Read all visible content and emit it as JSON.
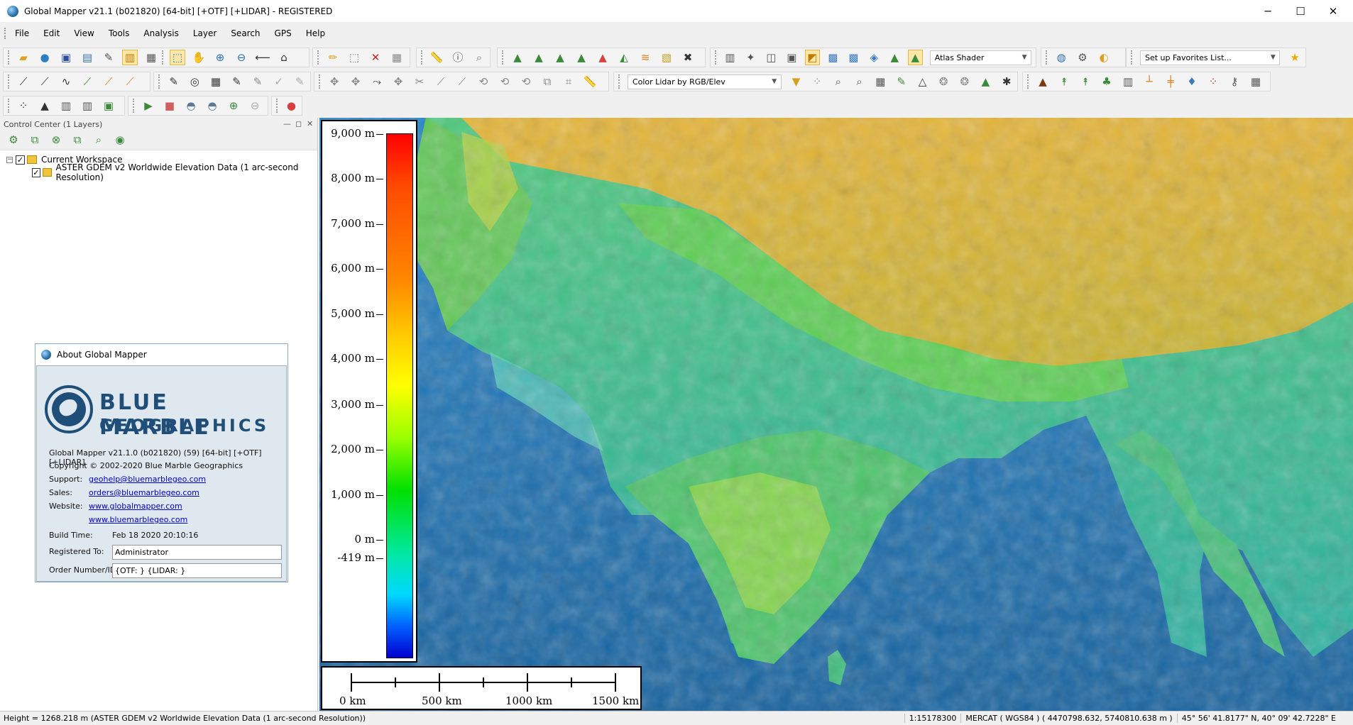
{
  "window": {
    "title": "Global Mapper v21.1 (b021820) [64-bit] [+OTF] [+LIDAR] - REGISTERED",
    "minimize_glyph": "─",
    "maximize_glyph": "☐",
    "close_glyph": "✕"
  },
  "menu": [
    "File",
    "Edit",
    "View",
    "Tools",
    "Analysis",
    "Layer",
    "Search",
    "GPS",
    "Help"
  ],
  "toolbar": {
    "shader_select": "Atlas Shader",
    "favorites_select": "Set up Favorites List...",
    "lidar_color_select": "Color Lidar by RGB/Elev"
  },
  "control_center": {
    "title": "Control Center (1 Layers)",
    "workspace_label": "Current Workspace",
    "layer_label": "ASTER GDEM v2 Worldwide Elevation Data (1 arc-second Resolution)"
  },
  "about": {
    "title": "About Global Mapper",
    "logo_line1": "BLUE MARBLE",
    "logo_line2": "GEOGRAPHICS",
    "version_line": "Global Mapper v21.1.0 (b021820) (59) [64-bit] [+OTF] [+LIDAR]",
    "copyright": "Copyright © 2002-2020 Blue Marble Geographics",
    "support_label": "Support:",
    "support_link": "geohelp@bluemarblegeo.com",
    "sales_label": "Sales:",
    "sales_link": "orders@bluemarblegeo.com",
    "website_label": "Website:",
    "website_link1": "www.globalmapper.com",
    "website_link2": "www.bluemarblegeo.com",
    "build_time_label": "Build Time:",
    "build_time_value": "Feb 18 2020 20:10:16",
    "registered_label": "Registered To:",
    "registered_value": "Administrator",
    "order_label": "Order Number/ID:",
    "order_value": "{OTF: } {LIDAR: }"
  },
  "legend": {
    "ticks": [
      "9,000 m",
      "8,000 m",
      "7,000 m",
      "6,000 m",
      "5,000 m",
      "4,000 m",
      "3,000 m",
      "2,000 m",
      "1,000 m",
      "0 m",
      "-419 m"
    ]
  },
  "scale_bar": {
    "labels": [
      "0 km",
      "500 km",
      "1000 km",
      "1500 km"
    ]
  },
  "status": {
    "left": "Height = 1268.218 m (ASTER GDEM v2 Worldwide Elevation Data (1 arc-second Resolution))",
    "scale": "1:15178300",
    "projection": "MERCAT ( WGS84 ) ( 4470798.632, 5740810.638 m )",
    "coords": "45° 56' 41.8177\" N, 40° 09' 42.7228\" E"
  }
}
